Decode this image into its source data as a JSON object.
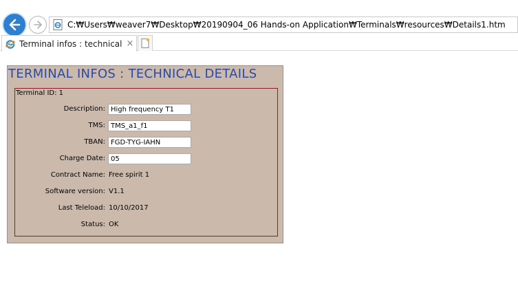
{
  "browser": {
    "address": "C:₩Users₩weaver7₩Desktop₩20190904_06 Hands-on Application₩Terminals₩resources₩Details1.htm",
    "tab_title": "Terminal infos : technical d...",
    "tab_close": "×",
    "icons": [
      "back-arrow-icon",
      "forward-arrow-icon",
      "page-icon",
      "ie-icon",
      "close-icon",
      "new-tab-icon"
    ],
    "accent": "#2f7fd0"
  },
  "page": {
    "title": "TERMINAL INFOS : TECHNICAL DETAILS",
    "terminal_id": "Terminal ID: 1",
    "colors": {
      "panel_bg": "#cbbaab",
      "title": "#2c4aa0",
      "box_border": "#8b1c2a"
    },
    "fields": {
      "description": {
        "label": "Description:",
        "value": "High frequency T1"
      },
      "tms": {
        "label": "TMS:",
        "value": "TMS_a1_f1"
      },
      "tban": {
        "label": "TBAN:",
        "value": "FGD-TYG-IAHN"
      },
      "charge_date": {
        "label": "Charge Date:",
        "value": "05"
      },
      "contract_name": {
        "label": "Contract Name:",
        "value": "Free spirit 1"
      },
      "software_version": {
        "label": "Software version:",
        "value": "V1.1"
      },
      "last_teleload": {
        "label": "Last Teleload:",
        "value": "10/10/2017"
      },
      "status": {
        "label": "Status:",
        "value": "OK"
      }
    }
  }
}
